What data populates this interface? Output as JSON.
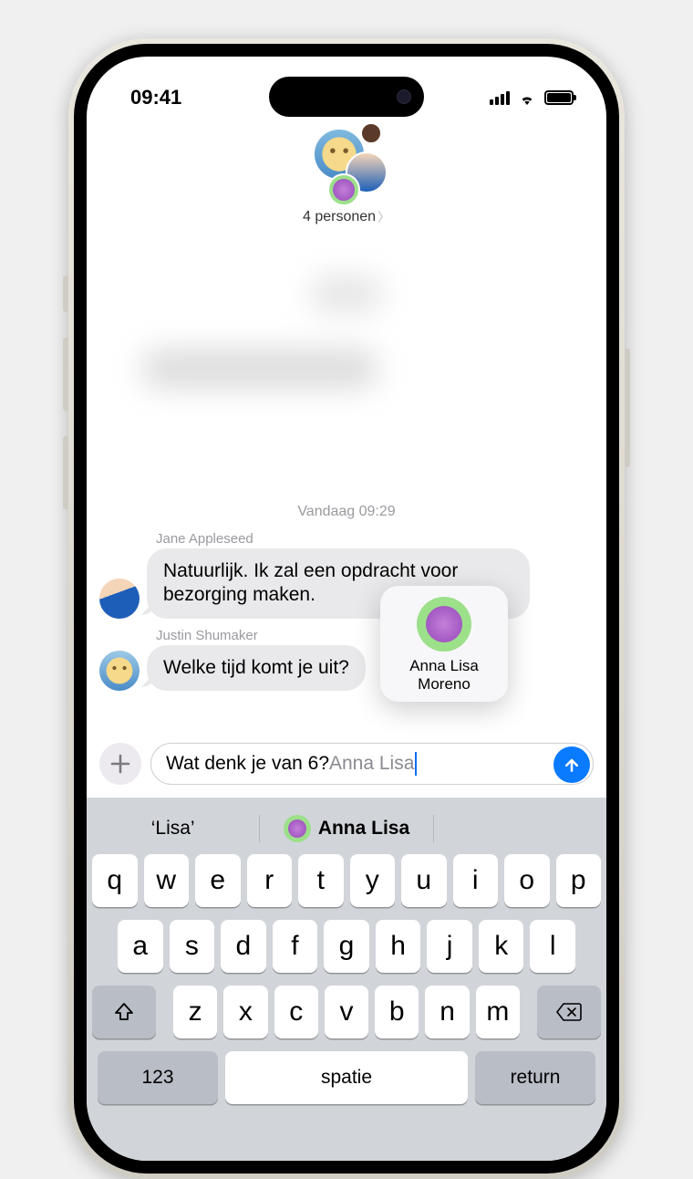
{
  "status": {
    "time": "09:41"
  },
  "header": {
    "group_label": "4 personen"
  },
  "timestamp": "Vandaag 09:29",
  "messages": [
    {
      "sender": "Jane Appleseed",
      "text": "Natuurlijk. Ik zal een opdracht voor bezorging maken."
    },
    {
      "sender": "Justin Shumaker",
      "text": "Welke tijd komt je uit?"
    }
  ],
  "mention_popover": {
    "name_line1": "Anna Lisa",
    "name_line2": "Moreno"
  },
  "compose": {
    "typed": "Wat denk je van 6? ",
    "mention": "Anna Lisa"
  },
  "predictions": {
    "left": "‘Lisa’",
    "right": "Anna Lisa"
  },
  "keyboard": {
    "row1": [
      "q",
      "w",
      "e",
      "r",
      "t",
      "y",
      "u",
      "i",
      "o",
      "p"
    ],
    "row2": [
      "a",
      "s",
      "d",
      "f",
      "g",
      "h",
      "j",
      "k",
      "l"
    ],
    "row3": [
      "z",
      "x",
      "c",
      "v",
      "b",
      "n",
      "m"
    ],
    "numbers_key": "123",
    "space_key": "spatie",
    "return_key": "return"
  }
}
